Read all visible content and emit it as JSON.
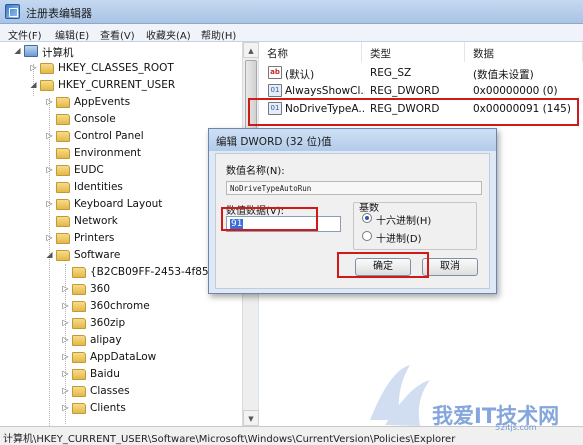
{
  "window": {
    "title": "注册表编辑器"
  },
  "menu": [
    {
      "label": "文件(F)"
    },
    {
      "label": "编辑(E)"
    },
    {
      "label": "查看(V)"
    },
    {
      "label": "收藏夹(A)"
    },
    {
      "label": "帮助(H)"
    }
  ],
  "tree": {
    "root": "计算机",
    "items": [
      {
        "label": "HKEY_CLASSES_ROOT"
      },
      {
        "label": "HKEY_CURRENT_USER"
      },
      {
        "label": "AppEvents"
      },
      {
        "label": "Console"
      },
      {
        "label": "Control Panel"
      },
      {
        "label": "Environment"
      },
      {
        "label": "EUDC"
      },
      {
        "label": "Identities"
      },
      {
        "label": "Keyboard Layout"
      },
      {
        "label": "Network"
      },
      {
        "label": "Printers"
      },
      {
        "label": "Software"
      },
      {
        "label": "{B2CB09FF-2453-4f85-9"
      },
      {
        "label": "360"
      },
      {
        "label": "360chrome"
      },
      {
        "label": "360zip"
      },
      {
        "label": "alipay"
      },
      {
        "label": "AppDataLow"
      },
      {
        "label": "Baidu"
      },
      {
        "label": "Classes"
      },
      {
        "label": "Clients"
      }
    ]
  },
  "values": {
    "headers": {
      "name": "名称",
      "type": "类型",
      "data": "数据"
    },
    "rows": [
      {
        "name": "(默认)",
        "type": "REG_SZ",
        "data": "(数值未设置)",
        "icon": "string-value-icon"
      },
      {
        "name": "AlwaysShowCl...",
        "type": "REG_DWORD",
        "data": "0x00000000 (0)",
        "icon": "dword-value-icon"
      },
      {
        "name": "NoDriveTypeA...",
        "type": "REG_DWORD",
        "data": "0x00000091 (145)",
        "icon": "dword-value-icon"
      }
    ]
  },
  "dialog": {
    "title": "编辑 DWORD (32 位)值",
    "name_label": "数值名称(N):",
    "name_value": "NoDriveTypeAutoRun",
    "data_label": "数值数据(V):",
    "data_value": "91",
    "base_label": "基数",
    "hex_label": "十六进制(H)",
    "dec_label": "十进制(D)",
    "ok_label": "确定",
    "cancel_label": "取消",
    "selected_base": "hex"
  },
  "status": {
    "path": "计算机\\HKEY_CURRENT_USER\\Software\\Microsoft\\Windows\\CurrentVersion\\Policies\\Explorer"
  },
  "watermark": {
    "text": "我爱IT技术网",
    "url": "52itjs.com"
  },
  "colors": {
    "highlight": "#d01a1a",
    "selection": "#3a6fd8"
  }
}
